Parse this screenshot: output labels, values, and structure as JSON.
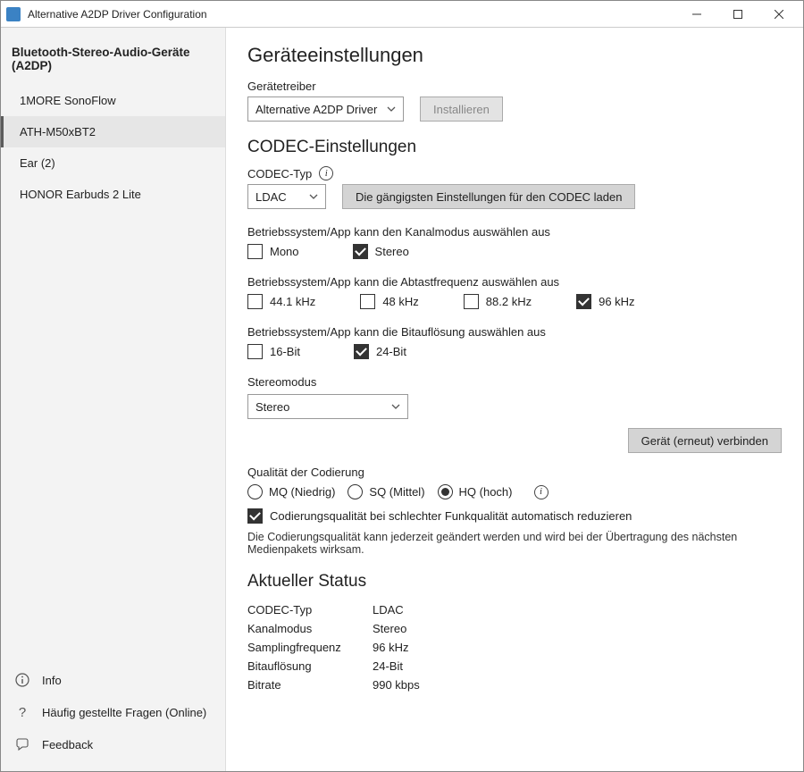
{
  "window": {
    "title": "Alternative A2DP Driver Configuration"
  },
  "sidebar": {
    "heading": "Bluetooth-Stereo-Audio-Geräte (A2DP)",
    "devices": [
      {
        "label": "1MORE SonoFlow",
        "selected": false
      },
      {
        "label": "ATH-M50xBT2",
        "selected": true
      },
      {
        "label": "Ear (2)",
        "selected": false
      },
      {
        "label": "HONOR Earbuds 2 Lite",
        "selected": false
      }
    ],
    "footer": [
      {
        "label": "Info"
      },
      {
        "label": "Häufig gestellte Fragen (Online)"
      },
      {
        "label": "Feedback"
      }
    ]
  },
  "settings": {
    "title": "Geräteeinstellungen",
    "driver_label": "Gerätetreiber",
    "driver_value": "Alternative A2DP Driver",
    "install_btn": "Installieren",
    "codec_heading": "CODEC-Einstellungen",
    "codec_type_label": "CODEC-Typ",
    "codec_value": "LDAC",
    "load_common_btn": "Die gängigsten Einstellungen für den CODEC laden",
    "channel_label": "Betriebssystem/App kann den Kanalmodus auswählen aus",
    "channel_opts": [
      {
        "label": "Mono",
        "checked": false
      },
      {
        "label": "Stereo",
        "checked": true
      }
    ],
    "sample_label": "Betriebssystem/App kann die Abtastfrequenz auswählen aus",
    "sample_opts": [
      {
        "label": "44.1 kHz",
        "checked": false
      },
      {
        "label": "48 kHz",
        "checked": false
      },
      {
        "label": "88.2 kHz",
        "checked": false
      },
      {
        "label": "96 kHz",
        "checked": true
      }
    ],
    "bitres_label": "Betriebssystem/App kann die Bitauflösung auswählen aus",
    "bitres_opts": [
      {
        "label": "16-Bit",
        "checked": false
      },
      {
        "label": "24-Bit",
        "checked": true
      }
    ],
    "stereomode_label": "Stereomodus",
    "stereomode_value": "Stereo",
    "reconnect_btn": "Gerät (erneut) verbinden",
    "quality_label": "Qualität der Codierung",
    "quality_opts": [
      {
        "label": "MQ (Niedrig)",
        "selected": false
      },
      {
        "label": "SQ (Mittel)",
        "selected": false
      },
      {
        "label": "HQ (hoch)",
        "selected": true
      }
    ],
    "auto_reduce": {
      "label": "Codierungsqualität bei schlechter Funkqualität automatisch reduzieren",
      "checked": true
    },
    "quality_note": "Die Codierungsqualität kann jederzeit geändert werden und wird bei der Übertragung des nächsten Medienpakets wirksam."
  },
  "status": {
    "heading": "Aktueller Status",
    "rows": [
      {
        "key": "CODEC-Typ",
        "value": "LDAC"
      },
      {
        "key": "Kanalmodus",
        "value": "Stereo"
      },
      {
        "key": "Samplingfrequenz",
        "value": "96 kHz"
      },
      {
        "key": "Bitauflösung",
        "value": "24-Bit"
      },
      {
        "key": "Bitrate",
        "value": "990 kbps"
      }
    ]
  }
}
